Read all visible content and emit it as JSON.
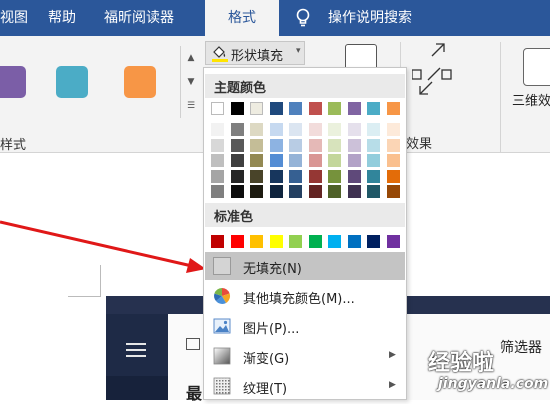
{
  "tabs": {
    "items": [
      "视图",
      "帮助",
      "福昕阅读器",
      "格式"
    ],
    "active": "格式",
    "tell_me": "操作说明搜索"
  },
  "ribbon": {
    "shape_styles_group_label": "样式",
    "shape_style_colors": [
      "#7b5ea7",
      "#4bacc6",
      "#f79646"
    ],
    "shape_fill_label": "形状填充",
    "effects_label": "效果",
    "three_d_label": "三维效"
  },
  "menu": {
    "theme_colors_header": "主题颜色",
    "standard_colors_header": "标准色",
    "theme_top_row": [
      "#ffffff",
      "#000000",
      "#eeece1",
      "#1f497d",
      "#4f81bd",
      "#c0504d",
      "#9bbb59",
      "#8064a2",
      "#4bacc6",
      "#f79646"
    ],
    "theme_shades": [
      [
        "#f2f2f2",
        "#7f7f7f",
        "#ddd9c3",
        "#c6d9f0",
        "#dbe5f1",
        "#f2dcdb",
        "#ebf1dd",
        "#e5e0ec",
        "#dbeef3",
        "#fdeada"
      ],
      [
        "#d8d8d8",
        "#595959",
        "#c4bd97",
        "#8db3e2",
        "#b8cce4",
        "#e5b9b7",
        "#d7e3bc",
        "#ccc1d9",
        "#b7dde8",
        "#fbd5b5"
      ],
      [
        "#bfbfbf",
        "#3f3f3f",
        "#938953",
        "#548dd4",
        "#95b3d7",
        "#d99694",
        "#c3d69b",
        "#b2a2c7",
        "#92cddc",
        "#fac08f"
      ],
      [
        "#a5a5a5",
        "#262626",
        "#494429",
        "#17365d",
        "#366092",
        "#953734",
        "#76923c",
        "#5f497a",
        "#31859b",
        "#e36c09"
      ],
      [
        "#7f7f7f",
        "#0c0c0c",
        "#1d1b10",
        "#0f243e",
        "#244061",
        "#632423",
        "#4f6128",
        "#3f3151",
        "#205867",
        "#974806"
      ]
    ],
    "standard_colors": [
      "#c00000",
      "#ff0000",
      "#ffc000",
      "#ffff00",
      "#92d050",
      "#00b050",
      "#00b0f0",
      "#0070c0",
      "#002060",
      "#7030a0"
    ],
    "items": [
      {
        "label": "无填充(N)",
        "icon": "no-fill-icon",
        "submenu": false
      },
      {
        "label": "其他填充颜色(M)...",
        "icon": "color-wheel-icon",
        "submenu": false
      },
      {
        "label": "图片(P)...",
        "icon": "picture-icon",
        "submenu": false
      },
      {
        "label": "渐变(G)",
        "icon": "gradient-icon",
        "submenu": true
      },
      {
        "label": "纹理(T)",
        "icon": "texture-icon",
        "submenu": true
      }
    ]
  },
  "document": {
    "embedded_filter_text": "筛选器",
    "embedded_heading_char": "最"
  },
  "watermark": {
    "text": "经验啦",
    "url": "jingyanla.com"
  }
}
